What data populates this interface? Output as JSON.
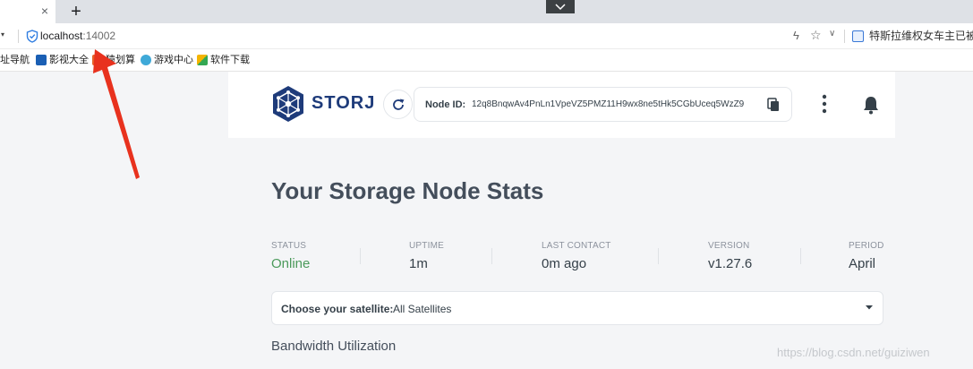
{
  "browser": {
    "tab_close": "×",
    "new_tab": "+",
    "url_host": "localhost",
    "url_port": ":14002",
    "news_text": "特斯拉维权女车主已被",
    "bookmarks": [
      "址导航",
      "影视大全",
      "猿划算",
      "游戏中心",
      "软件下载"
    ]
  },
  "header": {
    "logo_text": "STORJ",
    "node_id_label": "Node ID:",
    "node_id_value": "12q8BnqwAv4PnLn1VpeVZ5PMZ11H9wx8ne5tHk5CGbUceq5WzZ9"
  },
  "main": {
    "title": "Your Storage Node Stats",
    "stats": [
      {
        "label": "STATUS",
        "value": "Online"
      },
      {
        "label": "UPTIME",
        "value": "1m"
      },
      {
        "label": "LAST CONTACT",
        "value": "0m ago"
      },
      {
        "label": "VERSION",
        "value": "v1.27.6"
      },
      {
        "label": "PERIOD",
        "value": "April"
      }
    ],
    "satellite_label": "Choose your satellite:",
    "satellite_value": "All Satellites",
    "bandwidth_title": "Bandwidth Utilization"
  },
  "watermark": "https://blog.csdn.net/guiziwen",
  "colors": {
    "online": "#4b9a5b",
    "arrow": "#e8321e",
    "logo_blue": "#1e3b7a"
  }
}
